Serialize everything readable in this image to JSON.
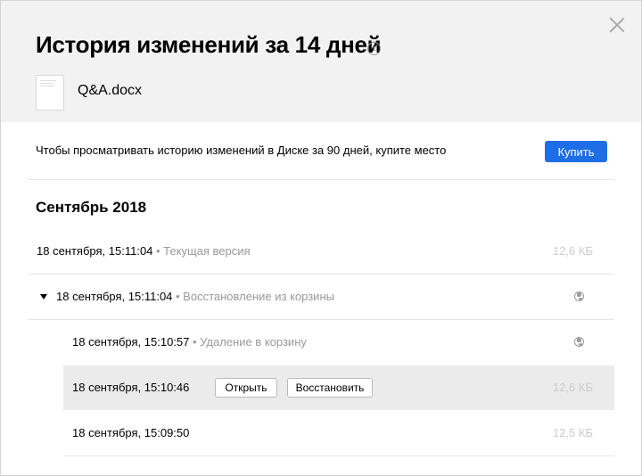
{
  "dialog": {
    "title": "История изменений за 14 дней",
    "file": {
      "name": "Q&A.docx",
      "icon": "docx-file-icon"
    },
    "close_icon": "close-icon",
    "info_icon": "info-icon",
    "info_glyph": "i"
  },
  "promo": {
    "text": "Чтобы просматривать историю изменений в Диске за 90 дней, купите место",
    "button": "Купить",
    "button_color": "#1e6fe6"
  },
  "history": {
    "month": "Сентябрь 2018",
    "rows": [
      {
        "time": "18 сентября, 15:11:04",
        "note": " • Текущая версия",
        "size": "12,6 КБ"
      },
      {
        "time": "18 сентября, 15:11:04",
        "note": " • Восстановление из корзины",
        "icon": "globe-icon",
        "expanded": true
      },
      {
        "time": "18 сентября, 15:10:57",
        "note": " • Удаление в корзину",
        "icon": "globe-icon"
      },
      {
        "time": "18 сентября, 15:10:46",
        "size": "12,6 КБ",
        "open_label": "Открыть",
        "restore_label": "Восстановить",
        "highlighted": true
      },
      {
        "time": "18 сентября, 15:09:50",
        "size": "12,5 КБ"
      }
    ]
  }
}
